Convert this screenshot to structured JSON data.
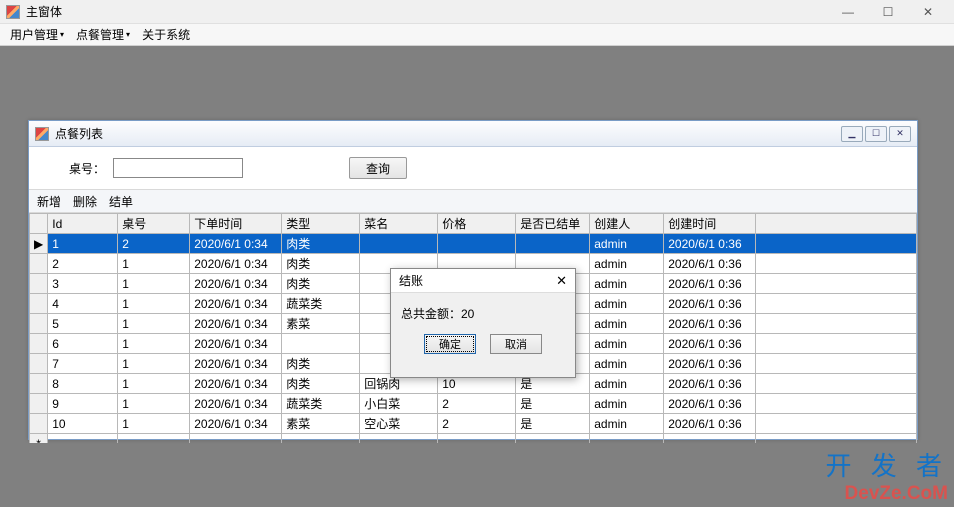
{
  "mainWindow": {
    "title": "主窗体"
  },
  "menu": {
    "userMgmt": "用户管理",
    "orderMgmt": "点餐管理",
    "about": "关于系统"
  },
  "childWindow": {
    "title": "点餐列表"
  },
  "search": {
    "label": "桌号：",
    "value": "",
    "queryBtn": "查询"
  },
  "toolbar": {
    "add": "新增",
    "delete": "删除",
    "settle": "结单"
  },
  "grid": {
    "headers": {
      "id": "Id",
      "tableNo": "桌号",
      "orderTime": "下单时间",
      "type": "类型",
      "dishName": "菜名",
      "price": "价格",
      "settled": "是否已结单",
      "creator": "创建人",
      "createTime": "创建时间"
    },
    "rows": [
      {
        "id": "1",
        "tableNo": "2",
        "orderTime": "2020/6/1 0:34",
        "type": "肉类",
        "dishName": "",
        "price": "",
        "settled": "",
        "creator": "admin",
        "createTime": "2020/6/1 0:36",
        "selected": true,
        "marker": "▶"
      },
      {
        "id": "2",
        "tableNo": "1",
        "orderTime": "2020/6/1 0:34",
        "type": "肉类",
        "dishName": "",
        "price": "",
        "settled": "",
        "creator": "admin",
        "createTime": "2020/6/1 0:36"
      },
      {
        "id": "3",
        "tableNo": "1",
        "orderTime": "2020/6/1 0:34",
        "type": "肉类",
        "dishName": "",
        "price": "",
        "settled": "",
        "creator": "admin",
        "createTime": "2020/6/1 0:36"
      },
      {
        "id": "4",
        "tableNo": "1",
        "orderTime": "2020/6/1 0:34",
        "type": "蔬菜类",
        "dishName": "",
        "price": "",
        "settled": "",
        "creator": "admin",
        "createTime": "2020/6/1 0:36"
      },
      {
        "id": "5",
        "tableNo": "1",
        "orderTime": "2020/6/1 0:34",
        "type": "素菜",
        "dishName": "",
        "price": "",
        "settled": "",
        "creator": "admin",
        "createTime": "2020/6/1 0:36"
      },
      {
        "id": "6",
        "tableNo": "1",
        "orderTime": "2020/6/1 0:34",
        "type": "",
        "dishName": "",
        "price": "",
        "settled": "",
        "creator": "admin",
        "createTime": "2020/6/1 0:36"
      },
      {
        "id": "7",
        "tableNo": "1",
        "orderTime": "2020/6/1 0:34",
        "type": "肉类",
        "dishName": "",
        "price": "",
        "settled": "",
        "creator": "admin",
        "createTime": "2020/6/1 0:36"
      },
      {
        "id": "8",
        "tableNo": "1",
        "orderTime": "2020/6/1 0:34",
        "type": "肉类",
        "dishName": "回锅肉",
        "price": "10",
        "settled": "是",
        "creator": "admin",
        "createTime": "2020/6/1 0:36"
      },
      {
        "id": "9",
        "tableNo": "1",
        "orderTime": "2020/6/1 0:34",
        "type": "蔬菜类",
        "dishName": "小白菜",
        "price": "2",
        "settled": "是",
        "creator": "admin",
        "createTime": "2020/6/1 0:36"
      },
      {
        "id": "10",
        "tableNo": "1",
        "orderTime": "2020/6/1 0:34",
        "type": "素菜",
        "dishName": "空心菜",
        "price": "2",
        "settled": "是",
        "creator": "admin",
        "createTime": "2020/6/1 0:36"
      },
      {
        "id": "",
        "tableNo": "",
        "orderTime": "",
        "type": "",
        "dishName": "",
        "price": "",
        "settled": "",
        "creator": "",
        "createTime": "",
        "marker": "*"
      }
    ]
  },
  "dialog": {
    "title": "结账",
    "message": "总共金额：20",
    "ok": "确定",
    "cancel": "取消"
  },
  "watermark": {
    "line1": "开 发 者",
    "line2": "DevZe.CoM"
  }
}
